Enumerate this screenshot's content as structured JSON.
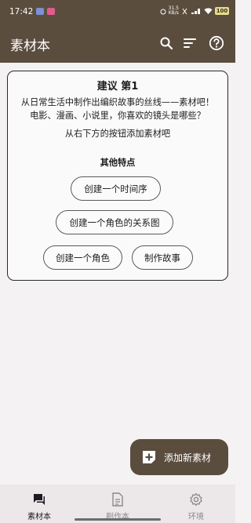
{
  "status_bar": {
    "time": "17:42",
    "speed_top": "31.5",
    "speed_bottom": "KB/s",
    "battery": "100"
  },
  "app_bar": {
    "title": "素材本",
    "icons": [
      "search-icon",
      "sort-icon",
      "help-icon"
    ]
  },
  "suggestion": {
    "title": "建议 第1",
    "description_line1": "从日常生活中制作出编织故事的丝线——素材吧！",
    "description_line2": "电影、漫画、小说里，你喜欢的镜头是哪些？",
    "hint": "从右下方的按钮添加素材吧",
    "other_features_heading": "其他特点",
    "buttons": [
      "创建一个时间序",
      "创建一个角色的关系图",
      "创建一个角色",
      "制作故事"
    ]
  },
  "fab": {
    "label": "添加新素材",
    "icon": "add-note-icon"
  },
  "bottom_nav": {
    "items": [
      {
        "label": "素材本",
        "icon": "chat-bubble-icon",
        "active": true
      },
      {
        "label": "剧作本",
        "icon": "document-icon",
        "active": false
      },
      {
        "label": "环境",
        "icon": "gear-icon",
        "active": false
      }
    ]
  },
  "colors": {
    "primary": "#5b4d3e",
    "background": "#f4f2f3",
    "nav_background": "#ece7e9"
  }
}
